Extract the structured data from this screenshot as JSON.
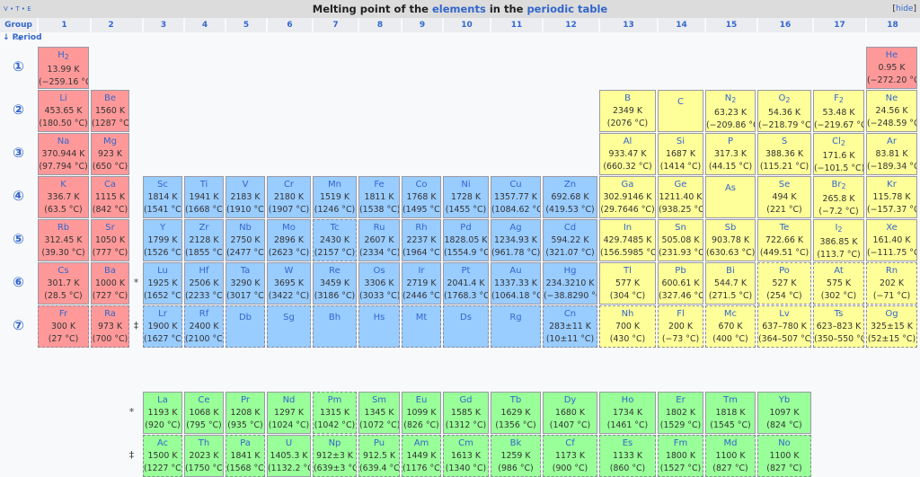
{
  "header": {
    "vte": "V • T • E",
    "title_pre": "Melting point of the ",
    "title_link1": "elements",
    "title_mid": " in the ",
    "title_link2": "periodic table",
    "hide_open": "[",
    "hide_label": "hide",
    "hide_close": "]"
  },
  "group_label": "Group →",
  "period_label": "↓ Period",
  "groups": [
    "1",
    "2",
    "3",
    "4",
    "5",
    "6",
    "7",
    "8",
    "9",
    "10",
    "11",
    "12",
    "13",
    "14",
    "15",
    "16",
    "17",
    "18"
  ],
  "periods": [
    "①",
    "②",
    "③",
    "④",
    "⑤",
    "⑥",
    "⑦"
  ],
  "series_markers": [
    "*",
    "‡"
  ],
  "colors": {
    "alkali_alkaline": "#ff9999",
    "transition": "#99ccff",
    "p_block": "#ffff99",
    "f_block": "#99ff99",
    "symbol": "#3366cc"
  },
  "elements": [
    {
      "s": "H",
      "sub": "2",
      "k": "13.99 K",
      "c": "(−259.16 °C)",
      "g": 1,
      "p": 1,
      "cat": "alkali_alkaline"
    },
    {
      "s": "He",
      "k": "0.95 K",
      "c": "(−272.20 °C)",
      "g": 18,
      "p": 1,
      "cat": "alkali_alkaline"
    },
    {
      "s": "Li",
      "k": "453.65 K",
      "c": "(180.50 °C)",
      "g": 1,
      "p": 2,
      "cat": "alkali_alkaline"
    },
    {
      "s": "Be",
      "k": "1560 K",
      "c": "(1287 °C)",
      "g": 2,
      "p": 2,
      "cat": "alkali_alkaline"
    },
    {
      "s": "B",
      "k": "2349 K",
      "c": "(2076 °C)",
      "g": 13,
      "p": 2,
      "cat": "p_block"
    },
    {
      "s": "C",
      "g": 14,
      "p": 2,
      "cat": "p_block"
    },
    {
      "s": "N",
      "sub": "2",
      "k": "63.23 K",
      "c": "(−209.86 °C)",
      "g": 15,
      "p": 2,
      "cat": "p_block"
    },
    {
      "s": "O",
      "sub": "2",
      "k": "54.36 K",
      "c": "(−218.79 °C)",
      "g": 16,
      "p": 2,
      "cat": "p_block"
    },
    {
      "s": "F",
      "sub": "2",
      "k": "53.48 K",
      "c": "(−219.67 °C)",
      "g": 17,
      "p": 2,
      "cat": "p_block"
    },
    {
      "s": "Ne",
      "k": "24.56 K",
      "c": "(−248.59 °C)",
      "g": 18,
      "p": 2,
      "cat": "p_block"
    },
    {
      "s": "Na",
      "k": "370.944 K",
      "c": "(97.794 °C)",
      "g": 1,
      "p": 3,
      "cat": "alkali_alkaline"
    },
    {
      "s": "Mg",
      "k": "923 K",
      "c": "(650 °C)",
      "g": 2,
      "p": 3,
      "cat": "alkali_alkaline"
    },
    {
      "s": "Al",
      "k": "933.47 K",
      "c": "(660.32 °C)",
      "g": 13,
      "p": 3,
      "cat": "p_block"
    },
    {
      "s": "Si",
      "k": "1687 K",
      "c": "(1414 °C)",
      "g": 14,
      "p": 3,
      "cat": "p_block"
    },
    {
      "s": "P",
      "k": "317.3 K",
      "c": "(44.15 °C)",
      "g": 15,
      "p": 3,
      "cat": "p_block"
    },
    {
      "s": "S",
      "k": "388.36 K",
      "c": "(115.21 °C)",
      "g": 16,
      "p": 3,
      "cat": "p_block"
    },
    {
      "s": "Cl",
      "sub": "2",
      "k": "171.6 K",
      "c": "(−101.5 °C)",
      "g": 17,
      "p": 3,
      "cat": "p_block"
    },
    {
      "s": "Ar",
      "k": "83.81 K",
      "c": "(−189.34 °C)",
      "g": 18,
      "p": 3,
      "cat": "p_block"
    },
    {
      "s": "K",
      "k": "336.7 K",
      "c": "(63.5 °C)",
      "g": 1,
      "p": 4,
      "cat": "alkali_alkaline"
    },
    {
      "s": "Ca",
      "k": "1115 K",
      "c": "(842 °C)",
      "g": 2,
      "p": 4,
      "cat": "alkali_alkaline"
    },
    {
      "s": "Sc",
      "k": "1814 K",
      "c": "(1541 °C)",
      "g": 3,
      "p": 4,
      "cat": "transition"
    },
    {
      "s": "Ti",
      "k": "1941 K",
      "c": "(1668 °C)",
      "g": 4,
      "p": 4,
      "cat": "transition"
    },
    {
      "s": "V",
      "k": "2183 K",
      "c": "(1910 °C)",
      "g": 5,
      "p": 4,
      "cat": "transition"
    },
    {
      "s": "Cr",
      "k": "2180 K",
      "c": "(1907 °C)",
      "g": 6,
      "p": 4,
      "cat": "transition"
    },
    {
      "s": "Mn",
      "k": "1519 K",
      "c": "(1246 °C)",
      "g": 7,
      "p": 4,
      "cat": "transition"
    },
    {
      "s": "Fe",
      "k": "1811 K",
      "c": "(1538 °C)",
      "g": 8,
      "p": 4,
      "cat": "transition"
    },
    {
      "s": "Co",
      "k": "1768 K",
      "c": "(1495 °C)",
      "g": 9,
      "p": 4,
      "cat": "transition"
    },
    {
      "s": "Ni",
      "k": "1728 K",
      "c": "(1455 °C)",
      "g": 10,
      "p": 4,
      "cat": "transition"
    },
    {
      "s": "Cu",
      "k": "1357.77 K",
      "c": "(1084.62 °C)",
      "g": 11,
      "p": 4,
      "cat": "transition"
    },
    {
      "s": "Zn",
      "k": "692.68 K",
      "c": "(419.53 °C)",
      "g": 12,
      "p": 4,
      "cat": "transition"
    },
    {
      "s": "Ga",
      "k": "302.9146 K",
      "c": "(29.7646 °C)",
      "g": 13,
      "p": 4,
      "cat": "p_block"
    },
    {
      "s": "Ge",
      "k": "1211.40 K",
      "c": "(938.25 °C)",
      "g": 14,
      "p": 4,
      "cat": "p_block"
    },
    {
      "s": "As",
      "g": 15,
      "p": 4,
      "cat": "p_block"
    },
    {
      "s": "Se",
      "k": "494 K",
      "c": "(221 °C)",
      "g": 16,
      "p": 4,
      "cat": "p_block"
    },
    {
      "s": "Br",
      "sub": "2",
      "k": "265.8 K",
      "c": "(−7.2 °C)",
      "g": 17,
      "p": 4,
      "cat": "p_block"
    },
    {
      "s": "Kr",
      "k": "115.78 K",
      "c": "(−157.37 °C)",
      "g": 18,
      "p": 4,
      "cat": "p_block"
    },
    {
      "s": "Rb",
      "k": "312.45 K",
      "c": "(39.30 °C)",
      "g": 1,
      "p": 5,
      "cat": "alkali_alkaline"
    },
    {
      "s": "Sr",
      "k": "1050 K",
      "c": "(777 °C)",
      "g": 2,
      "p": 5,
      "cat": "alkali_alkaline"
    },
    {
      "s": "Y",
      "k": "1799 K",
      "c": "(1526 °C)",
      "g": 3,
      "p": 5,
      "cat": "transition"
    },
    {
      "s": "Zr",
      "k": "2128 K",
      "c": "(1855 °C)",
      "g": 4,
      "p": 5,
      "cat": "transition"
    },
    {
      "s": "Nb",
      "k": "2750 K",
      "c": "(2477 °C)",
      "g": 5,
      "p": 5,
      "cat": "transition"
    },
    {
      "s": "Mo",
      "k": "2896 K",
      "c": "(2623 °C)",
      "g": 6,
      "p": 5,
      "cat": "transition"
    },
    {
      "s": "Tc",
      "k": "2430 K",
      "c": "(2157 °C)",
      "g": 7,
      "p": 5,
      "cat": "transition",
      "dash": true
    },
    {
      "s": "Ru",
      "k": "2607 K",
      "c": "(2334 °C)",
      "g": 8,
      "p": 5,
      "cat": "transition"
    },
    {
      "s": "Rh",
      "k": "2237 K",
      "c": "(1964 °C)",
      "g": 9,
      "p": 5,
      "cat": "transition"
    },
    {
      "s": "Pd",
      "k": "1828.05 K",
      "c": "(1554.9 °C)",
      "g": 10,
      "p": 5,
      "cat": "transition"
    },
    {
      "s": "Ag",
      "k": "1234.93 K",
      "c": "(961.78 °C)",
      "g": 11,
      "p": 5,
      "cat": "transition"
    },
    {
      "s": "Cd",
      "k": "594.22 K",
      "c": "(321.07 °C)",
      "g": 12,
      "p": 5,
      "cat": "transition"
    },
    {
      "s": "In",
      "k": "429.7485 K",
      "c": "(156.5985 °C)",
      "g": 13,
      "p": 5,
      "cat": "p_block"
    },
    {
      "s": "Sn",
      "k": "505.08 K",
      "c": "(231.93 °C)",
      "g": 14,
      "p": 5,
      "cat": "p_block"
    },
    {
      "s": "Sb",
      "k": "903.78 K",
      "c": "(630.63 °C)",
      "g": 15,
      "p": 5,
      "cat": "p_block"
    },
    {
      "s": "Te",
      "k": "722.66 K",
      "c": "(449.51 °C)",
      "g": 16,
      "p": 5,
      "cat": "p_block"
    },
    {
      "s": "I",
      "sub": "2",
      "k": "386.85 K",
      "c": "(113.7 °C)",
      "g": 17,
      "p": 5,
      "cat": "p_block"
    },
    {
      "s": "Xe",
      "k": "161.40 K",
      "c": "(−111.75 °C)",
      "g": 18,
      "p": 5,
      "cat": "p_block"
    },
    {
      "s": "Cs",
      "k": "301.7 K",
      "c": "(28.5 °C)",
      "g": 1,
      "p": 6,
      "cat": "alkali_alkaline"
    },
    {
      "s": "Ba",
      "k": "1000 K",
      "c": "(727 °C)",
      "g": 2,
      "p": 6,
      "cat": "alkali_alkaline"
    },
    {
      "s": "Lu",
      "k": "1925 K",
      "c": "(1652 °C)",
      "g": 3,
      "p": 6,
      "cat": "transition"
    },
    {
      "s": "Hf",
      "k": "2506 K",
      "c": "(2233 °C)",
      "g": 4,
      "p": 6,
      "cat": "transition"
    },
    {
      "s": "Ta",
      "k": "3290 K",
      "c": "(3017 °C)",
      "g": 5,
      "p": 6,
      "cat": "transition"
    },
    {
      "s": "W",
      "k": "3695 K",
      "c": "(3422 °C)",
      "g": 6,
      "p": 6,
      "cat": "transition"
    },
    {
      "s": "Re",
      "k": "3459 K",
      "c": "(3186 °C)",
      "g": 7,
      "p": 6,
      "cat": "transition"
    },
    {
      "s": "Os",
      "k": "3306 K",
      "c": "(3033 °C)",
      "g": 8,
      "p": 6,
      "cat": "transition"
    },
    {
      "s": "Ir",
      "k": "2719 K",
      "c": "(2446 °C)",
      "g": 9,
      "p": 6,
      "cat": "transition"
    },
    {
      "s": "Pt",
      "k": "2041.4 K",
      "c": "(1768.3 °C)",
      "g": 10,
      "p": 6,
      "cat": "transition"
    },
    {
      "s": "Au",
      "k": "1337.33 K",
      "c": "(1064.18 °C)",
      "g": 11,
      "p": 6,
      "cat": "transition"
    },
    {
      "s": "Hg",
      "k": "234.3210 K",
      "c": "(−38.8290 °C)",
      "g": 12,
      "p": 6,
      "cat": "transition"
    },
    {
      "s": "Tl",
      "k": "577 K",
      "c": "(304 °C)",
      "g": 13,
      "p": 6,
      "cat": "p_block"
    },
    {
      "s": "Pb",
      "k": "600.61 K",
      "c": "(327.46 °C)",
      "g": 14,
      "p": 6,
      "cat": "p_block"
    },
    {
      "s": "Bi",
      "k": "544.7 K",
      "c": "(271.5 °C)",
      "g": 15,
      "p": 6,
      "cat": "p_block"
    },
    {
      "s": "Po",
      "k": "527 K",
      "c": "(254 °C)",
      "g": 16,
      "p": 6,
      "cat": "p_block",
      "dash": true
    },
    {
      "s": "At",
      "k": "575 K",
      "c": "(302 °C)",
      "g": 17,
      "p": 6,
      "cat": "p_block",
      "dash": true
    },
    {
      "s": "Rn",
      "k": "202 K",
      "c": "(−71 °C)",
      "g": 18,
      "p": 6,
      "cat": "p_block",
      "dash": true
    },
    {
      "s": "Fr",
      "k": "300 K",
      "c": "(27 °C)",
      "g": 1,
      "p": 7,
      "cat": "alkali_alkaline",
      "dash": true
    },
    {
      "s": "Ra",
      "k": "973 K",
      "c": "(700 °C)",
      "g": 2,
      "p": 7,
      "cat": "alkali_alkaline",
      "dash": true
    },
    {
      "s": "Lr",
      "k": "1900 K",
      "c": "(1627 °C)",
      "g": 3,
      "p": 7,
      "cat": "transition",
      "dash": true
    },
    {
      "s": "Rf",
      "k": "2400 K",
      "c": "(2100 °C)",
      "g": 4,
      "p": 7,
      "cat": "transition",
      "dash": true
    },
    {
      "s": "Db",
      "g": 5,
      "p": 7,
      "cat": "transition",
      "dash": true
    },
    {
      "s": "Sg",
      "g": 6,
      "p": 7,
      "cat": "transition",
      "dash": true
    },
    {
      "s": "Bh",
      "g": 7,
      "p": 7,
      "cat": "transition",
      "dash": true
    },
    {
      "s": "Hs",
      "g": 8,
      "p": 7,
      "cat": "transition",
      "dash": true
    },
    {
      "s": "Mt",
      "g": 9,
      "p": 7,
      "cat": "transition",
      "dash": true
    },
    {
      "s": "Ds",
      "g": 10,
      "p": 7,
      "cat": "transition",
      "dash": true
    },
    {
      "s": "Rg",
      "g": 11,
      "p": 7,
      "cat": "transition",
      "dash": true
    },
    {
      "s": "Cn",
      "k": "283±11 K",
      "c": "(10±11 °C)",
      "g": 12,
      "p": 7,
      "cat": "transition",
      "dash": true
    },
    {
      "s": "Nh",
      "k": "700 K",
      "c": "(430 °C)",
      "g": 13,
      "p": 7,
      "cat": "p_block",
      "dash": true
    },
    {
      "s": "Fl",
      "k": "200 K",
      "c": "(−73 °C)",
      "g": 14,
      "p": 7,
      "cat": "p_block",
      "dash": true
    },
    {
      "s": "Mc",
      "k": "670 K",
      "c": "(400 °C)",
      "g": 15,
      "p": 7,
      "cat": "p_block",
      "dash": true
    },
    {
      "s": "Lv",
      "k": "637–780 K",
      "c": "(364–507 °C)",
      "g": 16,
      "p": 7,
      "cat": "p_block",
      "dash": true
    },
    {
      "s": "Ts",
      "k": "623–823 K",
      "c": "(350–550 °C)",
      "g": 17,
      "p": 7,
      "cat": "p_block",
      "dash": true
    },
    {
      "s": "Og",
      "k": "325±15 K",
      "c": "(52±15 °C)",
      "g": 18,
      "p": 7,
      "cat": "p_block",
      "dash": true
    }
  ],
  "lanthanides": [
    {
      "s": "La",
      "k": "1193 K",
      "c": "(920 °C)"
    },
    {
      "s": "Ce",
      "k": "1068 K",
      "c": "(795 °C)"
    },
    {
      "s": "Pr",
      "k": "1208 K",
      "c": "(935 °C)"
    },
    {
      "s": "Nd",
      "k": "1297 K",
      "c": "(1024 °C)"
    },
    {
      "s": "Pm",
      "k": "1315 K",
      "c": "(1042 °C)",
      "dash": true
    },
    {
      "s": "Sm",
      "k": "1345 K",
      "c": "(1072 °C)"
    },
    {
      "s": "Eu",
      "k": "1099 K",
      "c": "(826 °C)"
    },
    {
      "s": "Gd",
      "k": "1585 K",
      "c": "(1312 °C)"
    },
    {
      "s": "Tb",
      "k": "1629 K",
      "c": "(1356 °C)"
    },
    {
      "s": "Dy",
      "k": "1680 K",
      "c": "(1407 °C)"
    },
    {
      "s": "Ho",
      "k": "1734 K",
      "c": "(1461 °C)"
    },
    {
      "s": "Er",
      "k": "1802 K",
      "c": "(1529 °C)"
    },
    {
      "s": "Tm",
      "k": "1818 K",
      "c": "(1545 °C)"
    },
    {
      "s": "Yb",
      "k": "1097 K",
      "c": "(824 °C)"
    }
  ],
  "actinides": [
    {
      "s": "Ac",
      "k": "1500 K",
      "c": "(1227 °C)",
      "dash": true
    },
    {
      "s": "Th",
      "k": "2023 K",
      "c": "(1750 °C)"
    },
    {
      "s": "Pa",
      "k": "1841 K",
      "c": "(1568 °C)",
      "dash": true
    },
    {
      "s": "U",
      "k": "1405.3 K",
      "c": "(1132.2 °C)"
    },
    {
      "s": "Np",
      "k": "912±3 K",
      "c": "(639±3 °C)",
      "dash": true
    },
    {
      "s": "Pu",
      "k": "912.5 K",
      "c": "(639.4 °C)",
      "dash": true
    },
    {
      "s": "Am",
      "k": "1449 K",
      "c": "(1176 °C)",
      "dash": true
    },
    {
      "s": "Cm",
      "k": "1613 K",
      "c": "(1340 °C)",
      "dash": true
    },
    {
      "s": "Bk",
      "k": "1259 K",
      "c": "(986 °C)",
      "dash": true
    },
    {
      "s": "Cf",
      "k": "1173 K",
      "c": "(900 °C)",
      "dash": true
    },
    {
      "s": "Es",
      "k": "1133 K",
      "c": "(860 °C)",
      "dash": true
    },
    {
      "s": "Fm",
      "k": "1800 K",
      "c": "(1527 °C)",
      "dash": true
    },
    {
      "s": "Md",
      "k": "1100 K",
      "c": "(827 °C)",
      "dash": true
    },
    {
      "s": "No",
      "k": "1100 K",
      "c": "(827 °C)",
      "dash": true
    }
  ]
}
